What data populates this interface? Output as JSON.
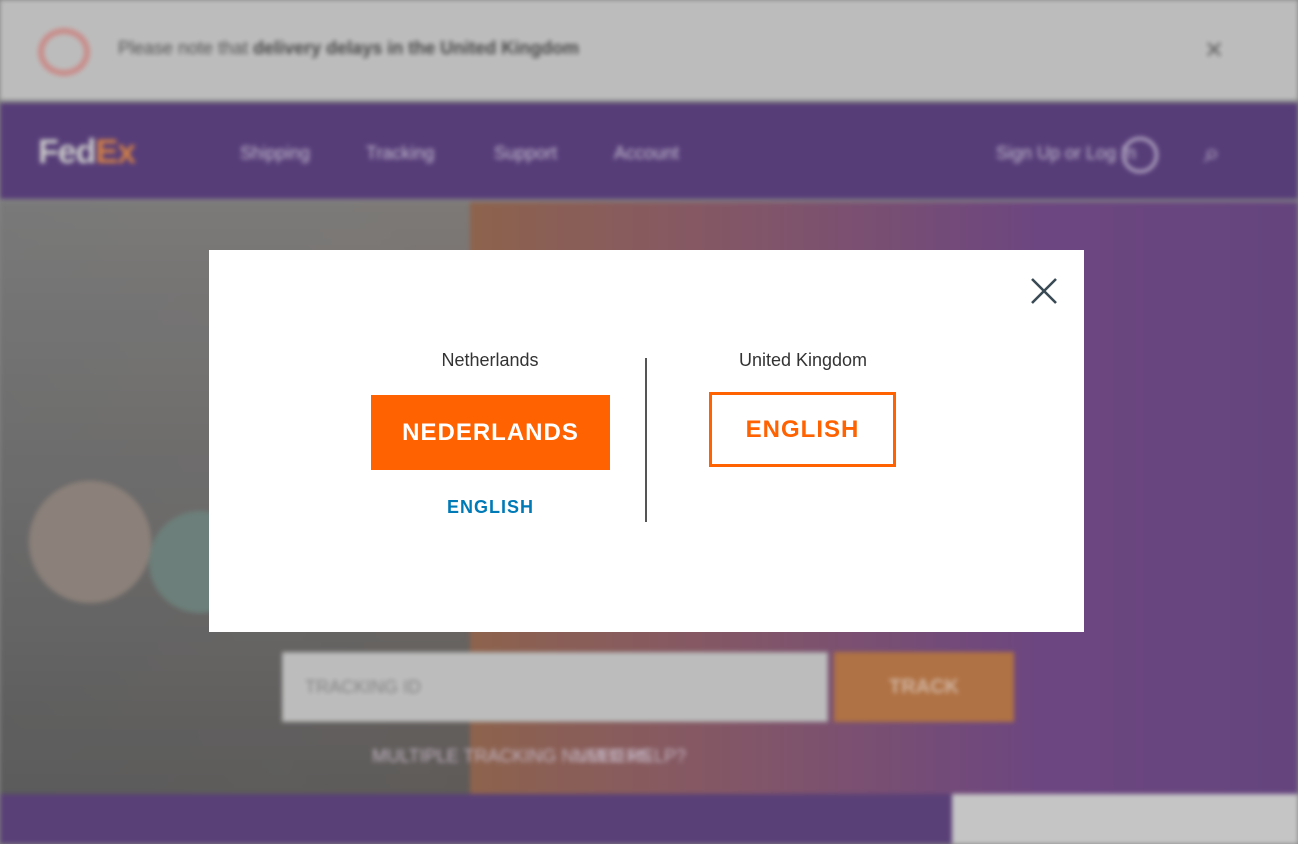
{
  "background": {
    "alert_bar": {
      "icon": "alert-circle-icon",
      "text_prefix": "Please note that",
      "text_link": "delivery delays in the United Kingdom",
      "close_icon": "close-icon"
    },
    "nav": {
      "logo_fed": "Fed",
      "logo_ex": "Ex",
      "items": [
        "Shipping",
        "Tracking",
        "Support",
        "Account"
      ],
      "sign_in": "Sign Up or Log In",
      "avatar_icon": "user-icon",
      "search_icon": "search-icon"
    },
    "hero": {
      "tracking_placeholder": "TRACKING ID",
      "track_button": "TRACK",
      "links": [
        "MULTIPLE TRACKING NUMBERS",
        "NEED HELP?"
      ]
    }
  },
  "modal": {
    "close_icon": "close-icon",
    "left": {
      "country": "Netherlands",
      "primary_language": "NEDERLANDS",
      "secondary_language": "ENGLISH"
    },
    "right": {
      "country": "United Kingdom",
      "language": "ENGLISH"
    }
  },
  "colors": {
    "accent_orange": "#ff6200",
    "link_blue": "#007ab7",
    "brand_purple": "#5b3e81"
  }
}
